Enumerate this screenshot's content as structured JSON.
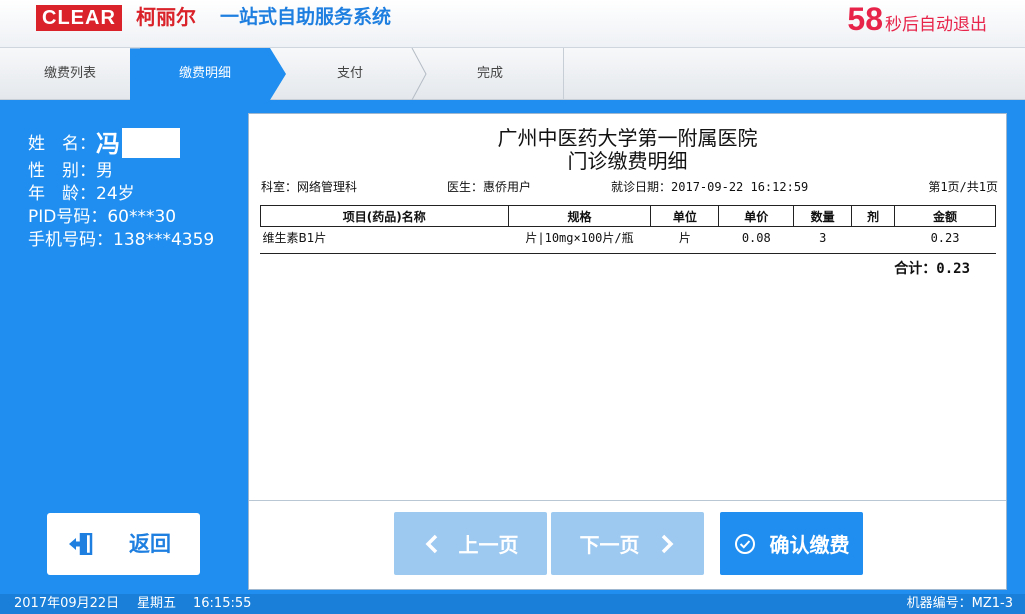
{
  "header": {
    "logo_text": "CLEAR",
    "logo_cn": "柯丽尔",
    "system_title": "一站式自助服务系统",
    "countdown_seconds": "58",
    "countdown_text": "秒后自动退出",
    "brand_color": "#d9222a",
    "accent_color": "#1f8ef0"
  },
  "steps": [
    {
      "label": "缴费列表",
      "active": false
    },
    {
      "label": "缴费明细",
      "active": true
    },
    {
      "label": "支付",
      "active": false
    },
    {
      "label": "完成",
      "active": false
    }
  ],
  "patient": {
    "name_label": "姓　名：",
    "name_value": "冯",
    "gender_label": "性　别：",
    "gender_value": "男",
    "age_label": "年　龄：",
    "age_value": "24岁",
    "pid_label": "PID号码：",
    "pid_value": "60***30",
    "phone_label": "手机号码：",
    "phone_value": "138***4359"
  },
  "back_button": {
    "label": "返回",
    "icon": "exit-door-icon"
  },
  "receipt": {
    "hospital": "广州中医药大学第一附属医院",
    "title": "门诊缴费明细",
    "dept_label": "科室：",
    "dept_value": "网络管理科",
    "doctor_label": "医生：",
    "doctor_value": "惠侨用户",
    "visit_label": "就诊日期：",
    "visit_value": "2017-09-22 16:12:59",
    "page_info": "第1页/共1页",
    "columns": [
      "项目(药品)名称",
      "规格",
      "单位",
      "单价",
      "数量",
      "剂",
      "金额"
    ],
    "rows": [
      [
        "维生素B1片",
        "片|10mg×100片/瓶",
        "片",
        "0.08",
        "3",
        "",
        "0.23"
      ]
    ],
    "total_label": "合计：",
    "total_value": "0.23"
  },
  "buttons": {
    "prev_label": "上一页",
    "next_label": "下一页",
    "confirm_label": "确认缴费"
  },
  "status": {
    "date": "2017年09月22日",
    "weekday": "星期五",
    "time": "16:15:55",
    "machine": "机器编号：MZ1-3"
  }
}
